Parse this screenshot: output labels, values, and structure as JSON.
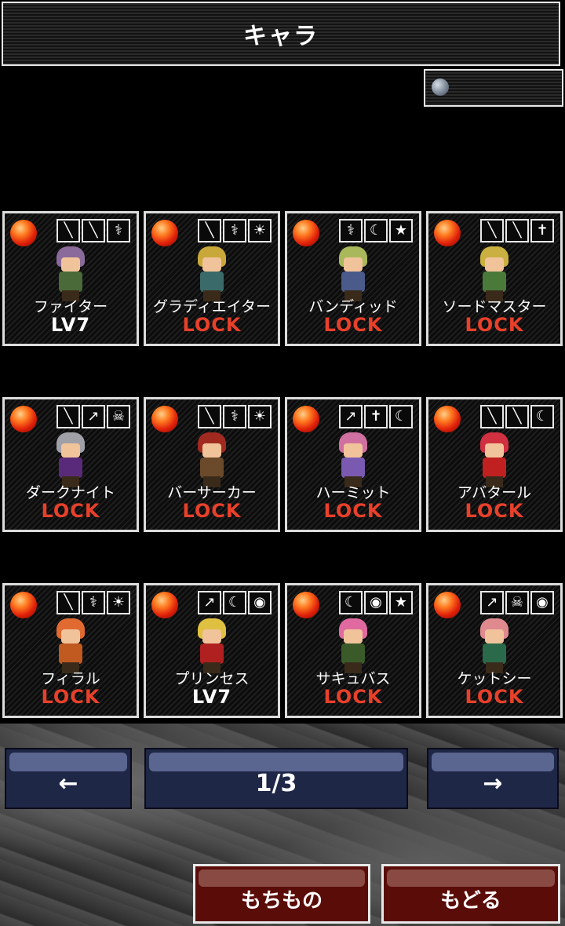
{
  "header": {
    "title": "キャラ"
  },
  "gem_counter": {
    "icon": "gem-icon",
    "value": ""
  },
  "characters": [
    {
      "name": "ファイター",
      "status": "LV7",
      "locked": false,
      "icons": [
        "╲",
        "╲",
        "⚕"
      ],
      "hair": "#8a6a9a",
      "body": "#4a6a3a"
    },
    {
      "name": "グラディエイター",
      "status": "LOCK",
      "locked": true,
      "icons": [
        "╲",
        "⚕",
        "☀"
      ],
      "hair": "#c9a83a",
      "body": "#3a6a6a"
    },
    {
      "name": "バンディッド",
      "status": "LOCK",
      "locked": true,
      "icons": [
        "⚕",
        "☾",
        "★"
      ],
      "hair": "#a9b85a",
      "body": "#4a5a8a"
    },
    {
      "name": "ソードマスター",
      "status": "LOCK",
      "locked": true,
      "icons": [
        "╲",
        "╲",
        "✝"
      ],
      "hair": "#c9b040",
      "body": "#4a7a3a"
    },
    {
      "name": "ダークナイト",
      "status": "LOCK",
      "locked": true,
      "icons": [
        "╲",
        "↗",
        "☠"
      ],
      "hair": "#a0a0a8",
      "body": "#5a2a7a"
    },
    {
      "name": "バーサーカー",
      "status": "LOCK",
      "locked": true,
      "icons": [
        "╲",
        "⚕",
        "☀"
      ],
      "hair": "#a02a20",
      "body": "#6a4a2a"
    },
    {
      "name": "ハーミット",
      "status": "LOCK",
      "locked": true,
      "icons": [
        "↗",
        "✝",
        "☾"
      ],
      "hair": "#d070a0",
      "body": "#7a5ab0"
    },
    {
      "name": "アバタール",
      "status": "LOCK",
      "locked": true,
      "icons": [
        "╲",
        "╲",
        "☾"
      ],
      "hair": "#d03040",
      "body": "#c02020"
    },
    {
      "name": "フィラル",
      "status": "LOCK",
      "locked": true,
      "icons": [
        "╲",
        "⚕",
        "☀"
      ],
      "hair": "#e06a30",
      "body": "#c05a20"
    },
    {
      "name": "プリンセス",
      "status": "LV7",
      "locked": false,
      "icons": [
        "↗",
        "☾",
        "◉"
      ],
      "hair": "#e0c040",
      "body": "#b02020"
    },
    {
      "name": "サキュバス",
      "status": "LOCK",
      "locked": true,
      "icons": [
        "☾",
        "◉",
        "★"
      ],
      "hair": "#e06aa0",
      "body": "#3a5a2a"
    },
    {
      "name": "ケットシー",
      "status": "LOCK",
      "locked": true,
      "icons": [
        "↗",
        "☠",
        "◉"
      ],
      "hair": "#e08a90",
      "body": "#2a6a4a"
    }
  ],
  "pagination": {
    "prev_label": "←",
    "page_label": "1/3",
    "next_label": "→"
  },
  "footer": {
    "items_label": "もちもの",
    "back_label": "もどる"
  }
}
